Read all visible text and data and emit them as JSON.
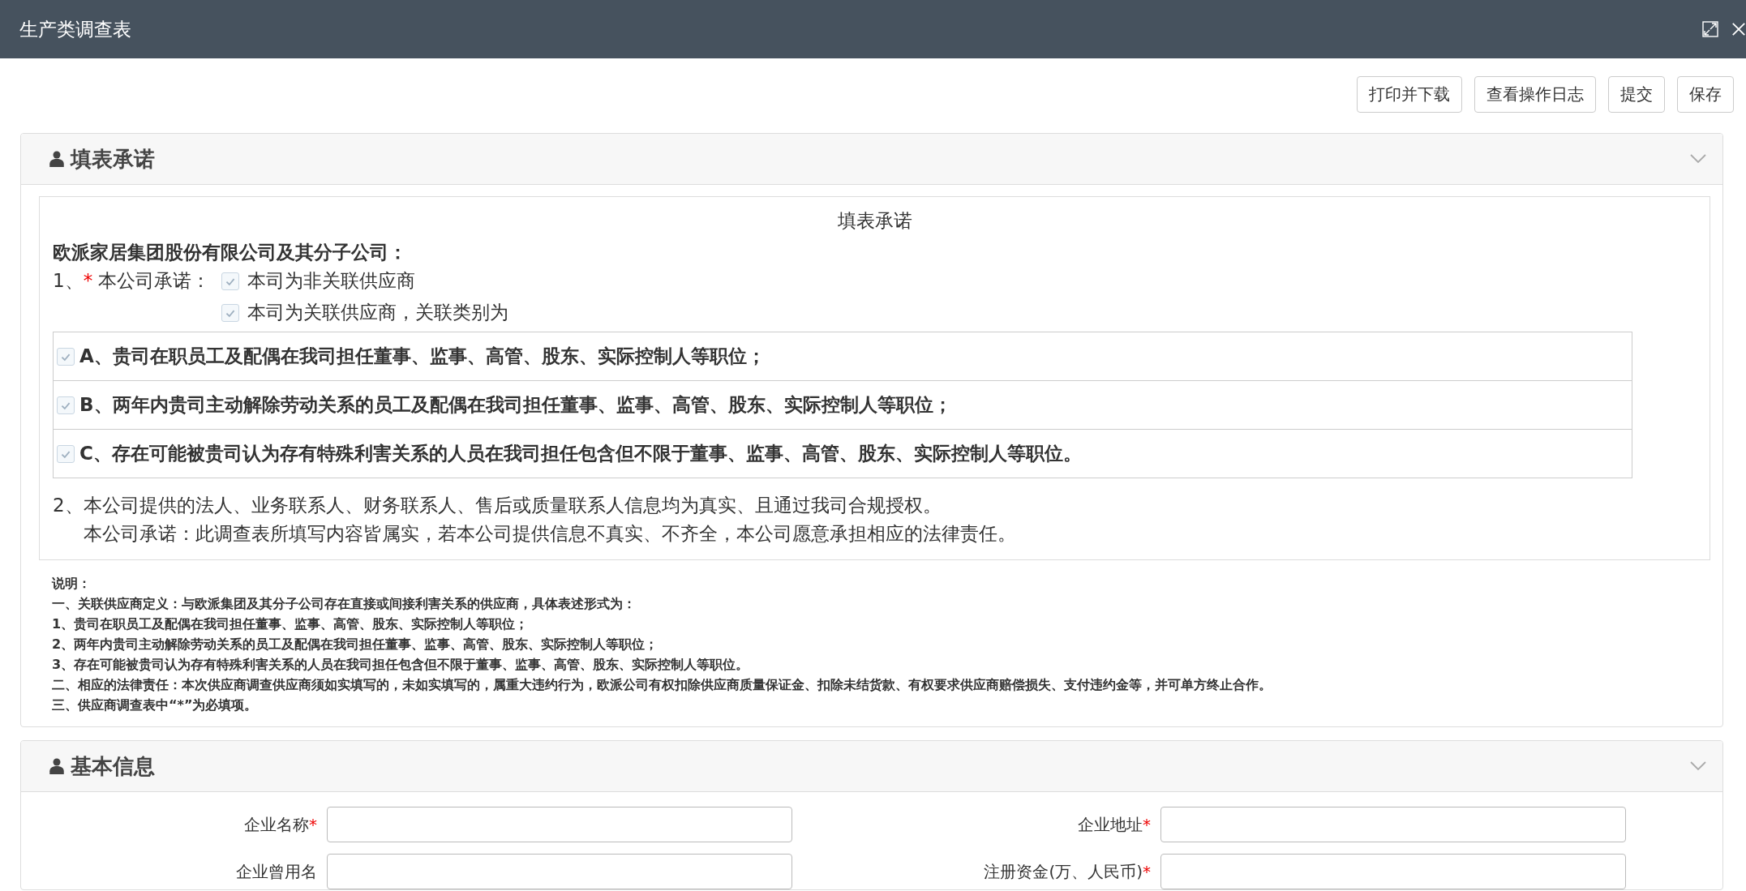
{
  "window": {
    "title": "生产类调查表"
  },
  "toolbar": [
    "打印并下载",
    "查看操作日志",
    "提交",
    "保存"
  ],
  "pledge": {
    "heading": "填表承诺",
    "expanded": true,
    "title": "填表承诺",
    "addressee": "欧派家居集团股份有限公司及其分子公司：",
    "item1": {
      "prefix": "1、",
      "required_mark": "*",
      "label": "本公司承诺：",
      "options": [
        {
          "label": "本司为非关联供应商",
          "checked": true,
          "disabled": true
        },
        {
          "label": "本司为关联供应商，关联类别为",
          "checked": true,
          "disabled": true
        }
      ]
    },
    "categories": [
      {
        "label": "A、贵司在职员工及配偶在我司担任董事、监事、高管、股东、实际控制人等职位；",
        "checked": true,
        "disabled": true
      },
      {
        "label": "B、两年内贵司主动解除劳动关系的员工及配偶在我司担任董事、监事、高管、股东、实际控制人等职位；",
        "checked": true,
        "disabled": true
      },
      {
        "label": "C、存在可能被贵司认为存有特殊利害关系的人员在我司担任包含但不限于董事、监事、高管、股东、实际控制人等职位。",
        "checked": true,
        "disabled": true
      }
    ],
    "item2": "2、本公司提供的法人、业务联系人、财务联系人、售后或质量联系人信息均为真实、且通过我司合规授权。",
    "statement": "本公司承诺：此调查表所填写内容皆属实，若本公司提供信息不真实、不齐全，本公司愿意承担相应的法律责任。",
    "notes": [
      "说明：",
      "一、关联供应商定义：与欧派集团及其分子公司存在直接或间接利害关系的供应商，具体表述形式为：",
      "1、贵司在职员工及配偶在我司担任董事、监事、高管、股东、实际控制人等职位；",
      "2、两年内贵司主动解除劳动关系的员工及配偶在我司担任董事、监事、高管、股东、实际控制人等职位；",
      "3、存在可能被贵司认为存有特殊利害关系的人员在我司担任包含但不限于董事、监事、高管、股东、实际控制人等职位。",
      "二、相应的法律责任：本次供应商调查供应商须如实填写的，未如实填写的，属重大违约行为，欧派公司有权扣除供应商质量保证金、扣除未结货款、有权要求供应商赔偿损失、支付违约金等，并可单方终止合作。",
      "三、供应商调查表中“*”为必填项。"
    ]
  },
  "basic_info": {
    "heading": "基本信息",
    "expanded": true,
    "fields": [
      {
        "label": "企业名称",
        "required_mark": "*"
      },
      {
        "label": "企业地址",
        "required_mark": "*"
      },
      {
        "label": "企业曾用名"
      },
      {
        "label": "注册资金(万、人民币)",
        "required_mark": "*"
      }
    ]
  }
}
